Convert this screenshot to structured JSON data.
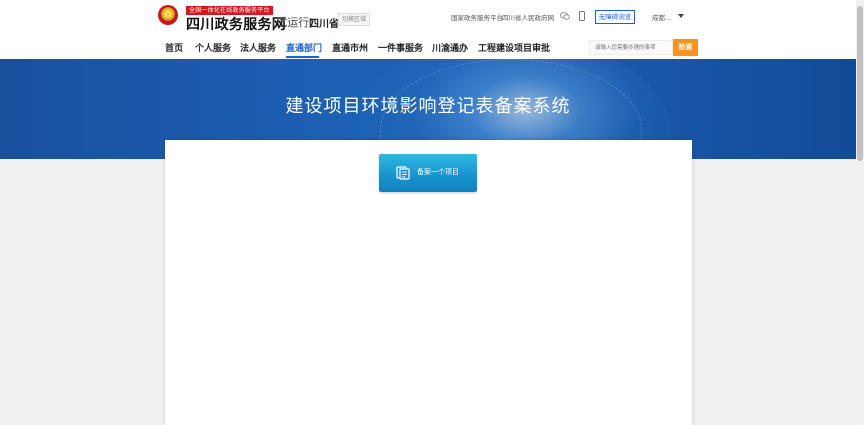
{
  "header": {
    "tagline": "全国一体化在线政务服务平台",
    "brand": "四川政务服务网",
    "trial": "(试运行)",
    "province": "四川省",
    "region_switch": "切换区域",
    "links": [
      "国家政务服务平台",
      "四川省人民政府网"
    ],
    "separator": "|",
    "accessibility": "无障碍浏览",
    "location": "成都..."
  },
  "nav": {
    "items": [
      "首页",
      "个人服务",
      "法人服务",
      "直通部门",
      "直通市州",
      "一件事服务",
      "川渝通办",
      "工程建设项目审批"
    ],
    "active_index": 3,
    "search_placeholder": "请输入您需要办理的事项",
    "search_button": "检索"
  },
  "banner": {
    "title": "建设项目环境影响登记表备案系统"
  },
  "main": {
    "record_button": "备案一个项目"
  },
  "colors": {
    "primary": "#1a61d6",
    "search": "#f7931e",
    "banner": "#1c61b5",
    "tagline": "#d7161e",
    "button": "#1996cf"
  }
}
